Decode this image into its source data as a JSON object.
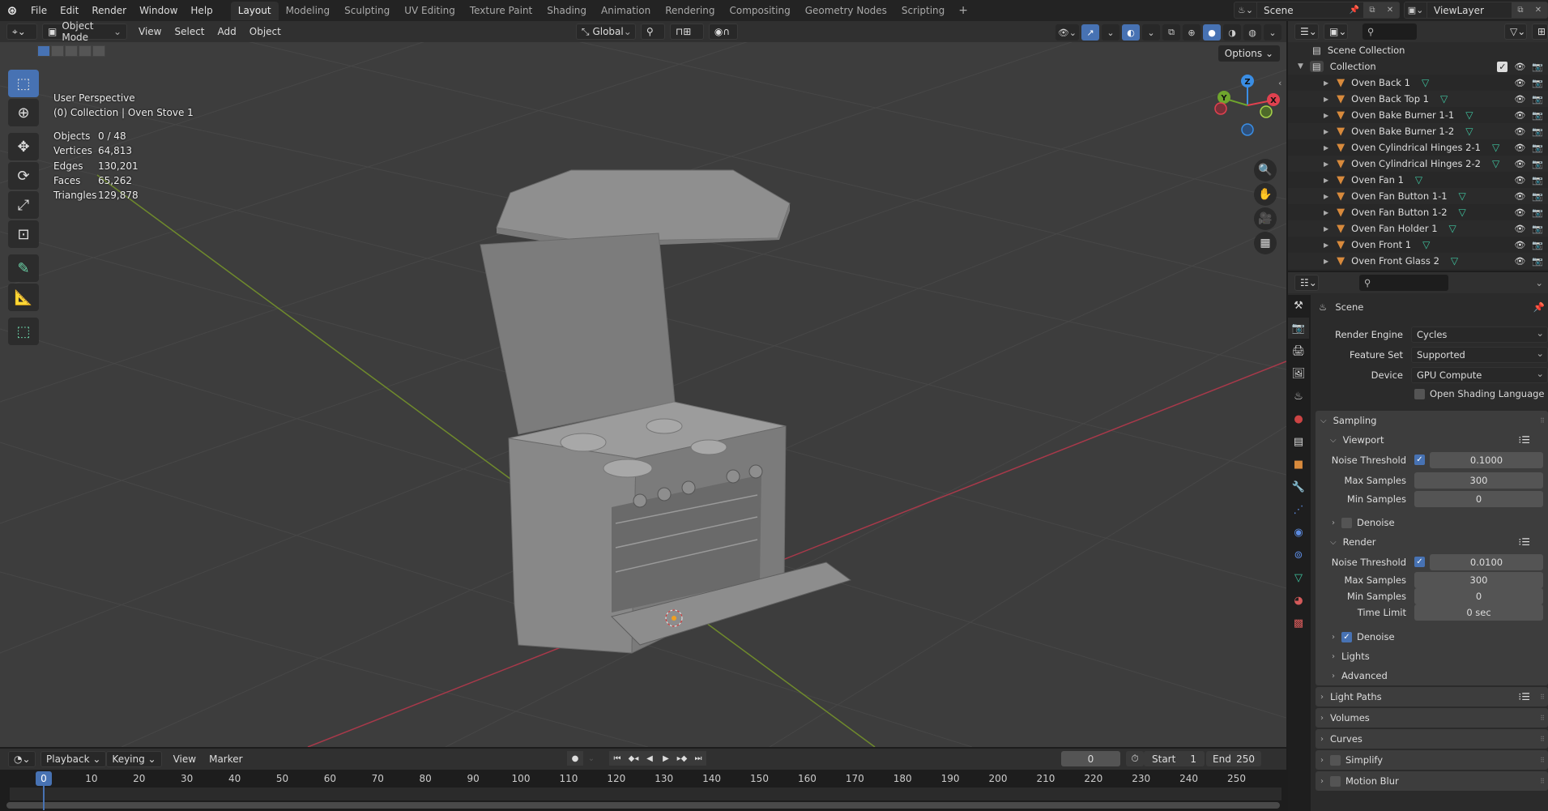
{
  "topbar": {
    "menu": [
      "File",
      "Edit",
      "Render",
      "Window",
      "Help"
    ],
    "workspaces": [
      "Layout",
      "Modeling",
      "Sculpting",
      "UV Editing",
      "Texture Paint",
      "Shading",
      "Animation",
      "Rendering",
      "Compositing",
      "Geometry Nodes",
      "Scripting"
    ],
    "active_workspace": "Layout",
    "scene": "Scene",
    "view_layer": "ViewLayer"
  },
  "viewport": {
    "mode": "Object Mode",
    "menus": [
      "View",
      "Select",
      "Add",
      "Object"
    ],
    "orientation": "Global",
    "options_label": "Options",
    "perspective": "User Perspective",
    "context": "(0) Collection | Oven Stove 1",
    "stats": [
      {
        "label": "Objects",
        "value": "0 / 48"
      },
      {
        "label": "Vertices",
        "value": "64,813"
      },
      {
        "label": "Edges",
        "value": "130,201"
      },
      {
        "label": "Faces",
        "value": "65,262"
      },
      {
        "label": "Triangles",
        "value": "129,878"
      }
    ],
    "gizmo_axes": {
      "x": "X",
      "y": "Y",
      "z": "Z"
    },
    "colors": {
      "x": "#e0414f",
      "y": "#6fa52d",
      "z": "#3a8ee5",
      "accent": "#4772b3"
    }
  },
  "timeline": {
    "menus": [
      "Playback",
      "Keying",
      "View",
      "Marker"
    ],
    "current_frame": "0",
    "start_label": "Start",
    "start": "1",
    "end_label": "End",
    "end": "250",
    "ticks": [
      "0",
      "10",
      "20",
      "30",
      "40",
      "50",
      "60",
      "70",
      "80",
      "90",
      "100",
      "110",
      "120",
      "130",
      "140",
      "150",
      "160",
      "170",
      "180",
      "190",
      "200",
      "210",
      "220",
      "230",
      "240",
      "250"
    ]
  },
  "outliner": {
    "root": "Scene Collection",
    "collection": "Collection",
    "items": [
      "Oven Back 1",
      "Oven Back Top 1",
      "Oven Bake Burner 1-1",
      "Oven Bake Burner 1-2",
      "Oven Cylindrical Hinges 2-1",
      "Oven Cylindrical Hinges 2-2",
      "Oven Fan 1",
      "Oven Fan Button 1-1",
      "Oven Fan Button 1-2",
      "Oven Fan Holder 1",
      "Oven Front 1",
      "Oven Front Glass 2"
    ]
  },
  "properties": {
    "context": "Scene",
    "render_engine_label": "Render Engine",
    "render_engine": "Cycles",
    "feature_set_label": "Feature Set",
    "feature_set": "Supported",
    "device_label": "Device",
    "device": "GPU Compute",
    "osl_label": "Open Shading Language",
    "sampling": "Sampling",
    "viewport": {
      "title": "Viewport",
      "noise_threshold_label": "Noise Threshold",
      "noise_threshold": "0.1000",
      "max_samples_label": "Max Samples",
      "max_samples": "300",
      "min_samples_label": "Min Samples",
      "min_samples": "0",
      "denoise_label": "Denoise"
    },
    "render": {
      "title": "Render",
      "noise_threshold_label": "Noise Threshold",
      "noise_threshold": "0.0100",
      "max_samples_label": "Max Samples",
      "max_samples": "300",
      "min_samples_label": "Min Samples",
      "min_samples": "0",
      "time_limit_label": "Time Limit",
      "time_limit": "0 sec",
      "denoise_label": "Denoise"
    },
    "sub_panels": [
      "Lights",
      "Advanced"
    ],
    "panels": [
      "Light Paths",
      "Volumes",
      "Curves",
      "Simplify",
      "Motion Blur"
    ]
  }
}
